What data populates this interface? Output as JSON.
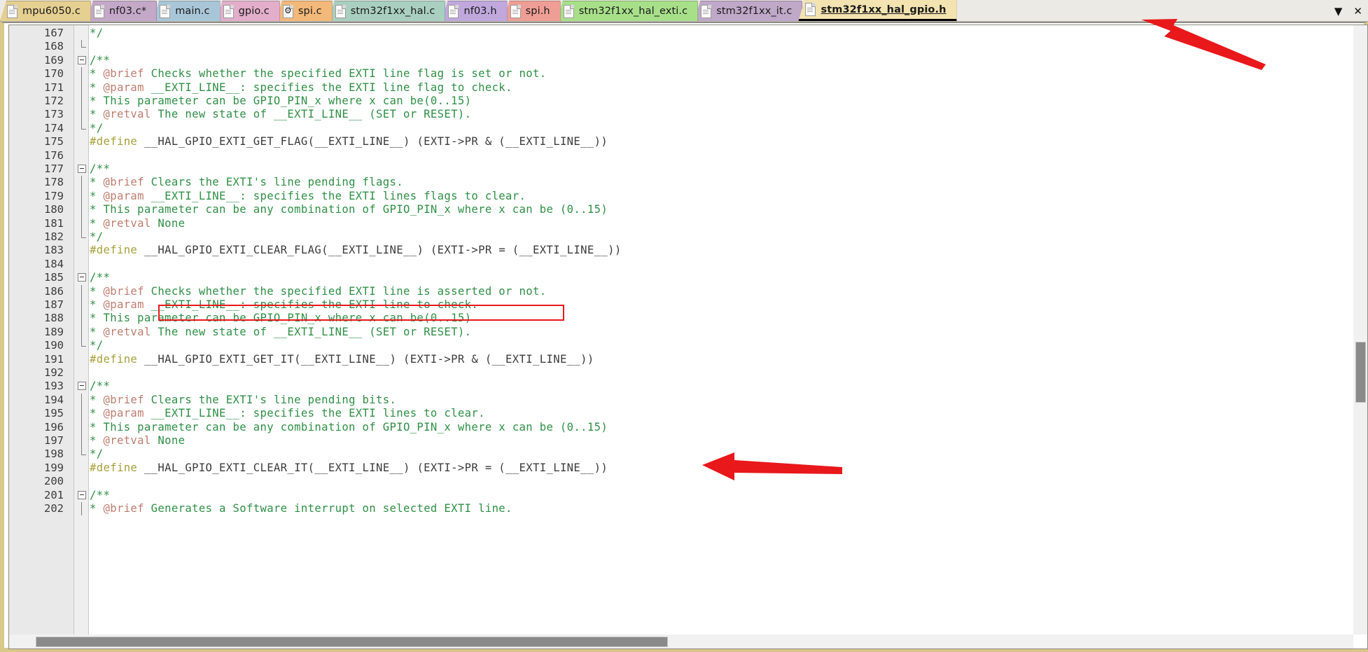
{
  "window": {
    "title": "stm32f1xx_hal_gpio.h",
    "accent_frame_color": "#d8c98b",
    "annotation_color": "#e8181b"
  },
  "tabbar": {
    "controls": [
      {
        "name": "tab-list-dropdown",
        "glyph": "▼",
        "label": "Tab list"
      },
      {
        "name": "close-tab-button",
        "glyph": "✕",
        "label": "Close"
      }
    ],
    "tabs": [
      {
        "label": "mpu6050.c",
        "color": "#e5cf91",
        "icon": "file-icon",
        "active": false,
        "modified": false
      },
      {
        "label": "nf03.c*",
        "color": "#c4a8c8",
        "icon": "file-icon",
        "active": false,
        "modified": true
      },
      {
        "label": "main.c",
        "color": "#a9c6d8",
        "icon": "file-icon",
        "active": false,
        "modified": false
      },
      {
        "label": "gpio.c",
        "color": "#e2aec9",
        "icon": "file-icon",
        "active": false,
        "modified": false
      },
      {
        "label": "spi.c",
        "color": "#f2b97a",
        "icon": "gear-file-icon",
        "active": false,
        "modified": false
      },
      {
        "label": "stm32f1xx_hal.c",
        "color": "#a9cfc0",
        "icon": "file-icon",
        "active": false,
        "modified": false
      },
      {
        "label": "nf03.h",
        "color": "#c0a8dd",
        "icon": "file-icon",
        "active": false,
        "modified": false
      },
      {
        "label": "spi.h",
        "color": "#ef9e95",
        "icon": "file-icon",
        "active": false,
        "modified": false
      },
      {
        "label": "stm32f1xx_hal_exti.c",
        "color": "#a8e08a",
        "icon": "file-icon",
        "active": false,
        "modified": false
      },
      {
        "label": "stm32f1xx_it.c",
        "color": "#c0a8c8",
        "icon": "file-icon",
        "active": false,
        "modified": false
      },
      {
        "label": "stm32f1xx_hal_gpio.h",
        "color": "#f2e3b0",
        "icon": "file-icon",
        "active": true,
        "modified": false
      }
    ]
  },
  "editor": {
    "first_line": 167,
    "syntax_colors": {
      "comment": "#2f8f46",
      "doc_tag": "#bf7d6e",
      "preprocessor": "#a6a13a",
      "identifier": "#3c3c3c",
      "gutter_bg": "#e9e9e9",
      "background": "#ffffff"
    },
    "lines": [
      {
        "n": 167,
        "fold": "none",
        "segs": [
          {
            "t": "   */",
            "c": "comment"
          }
        ]
      },
      {
        "n": 168,
        "fold": "end",
        "segs": []
      },
      {
        "n": 169,
        "fold": "start",
        "segs": [
          {
            "t": "/**",
            "c": "comment"
          }
        ]
      },
      {
        "n": 170,
        "fold": "mid",
        "segs": [
          {
            "t": "  * ",
            "c": "comment"
          },
          {
            "t": "@brief",
            "c": "doctag"
          },
          {
            "t": "  Checks whether the specified EXTI line flag is set or not.",
            "c": "comment"
          }
        ]
      },
      {
        "n": 171,
        "fold": "mid",
        "segs": [
          {
            "t": "  * ",
            "c": "comment"
          },
          {
            "t": "@param",
            "c": "doctag"
          },
          {
            "t": "  __EXTI_LINE__: specifies the EXTI line flag to check.",
            "c": "comment"
          }
        ]
      },
      {
        "n": 172,
        "fold": "mid",
        "segs": [
          {
            "t": "  *         This parameter can be GPIO_PIN_x where x can be(0..15)",
            "c": "comment"
          }
        ]
      },
      {
        "n": 173,
        "fold": "mid",
        "segs": [
          {
            "t": "  * ",
            "c": "comment"
          },
          {
            "t": "@retval",
            "c": "doctag"
          },
          {
            "t": " The new state of __EXTI_LINE__ (SET or RESET).",
            "c": "comment"
          }
        ]
      },
      {
        "n": 174,
        "fold": "end",
        "segs": [
          {
            "t": "  */",
            "c": "comment"
          }
        ]
      },
      {
        "n": 175,
        "fold": "none",
        "segs": [
          {
            "t": "#define",
            "c": "pre"
          },
          {
            "t": " __HAL_GPIO_EXTI_GET_FLAG(__EXTI_LINE__) (EXTI->PR & (__EXTI_LINE__))",
            "c": "ident"
          }
        ]
      },
      {
        "n": 176,
        "fold": "none",
        "segs": []
      },
      {
        "n": 177,
        "fold": "start",
        "segs": [
          {
            "t": "/**",
            "c": "comment"
          }
        ]
      },
      {
        "n": 178,
        "fold": "mid",
        "segs": [
          {
            "t": "  * ",
            "c": "comment"
          },
          {
            "t": "@brief",
            "c": "doctag"
          },
          {
            "t": "  Clears the EXTI's line pending flags.",
            "c": "comment"
          }
        ]
      },
      {
        "n": 179,
        "fold": "mid",
        "segs": [
          {
            "t": "  * ",
            "c": "comment"
          },
          {
            "t": "@param",
            "c": "doctag"
          },
          {
            "t": "  __EXTI_LINE__: specifies the EXTI lines flags to clear.",
            "c": "comment"
          }
        ]
      },
      {
        "n": 180,
        "fold": "mid",
        "segs": [
          {
            "t": "  *        This parameter can be any combination of GPIO_PIN_x where x can be (0..15)",
            "c": "comment"
          }
        ]
      },
      {
        "n": 181,
        "fold": "mid",
        "segs": [
          {
            "t": "  * ",
            "c": "comment"
          },
          {
            "t": "@retval",
            "c": "doctag"
          },
          {
            "t": " None",
            "c": "comment"
          }
        ]
      },
      {
        "n": 182,
        "fold": "end",
        "segs": [
          {
            "t": "  */",
            "c": "comment"
          }
        ]
      },
      {
        "n": 183,
        "fold": "none",
        "segs": [
          {
            "t": "#define",
            "c": "pre"
          },
          {
            "t": " __HAL_GPIO_EXTI_CLEAR_FLAG(__EXTI_LINE__) (EXTI->PR = (__EXTI_LINE__))",
            "c": "ident"
          }
        ]
      },
      {
        "n": 184,
        "fold": "none",
        "segs": []
      },
      {
        "n": 185,
        "fold": "start",
        "segs": [
          {
            "t": "/**",
            "c": "comment"
          }
        ]
      },
      {
        "n": 186,
        "fold": "mid",
        "segs": [
          {
            "t": "  * ",
            "c": "comment"
          },
          {
            "t": "@brief",
            "c": "doctag"
          },
          {
            "t": "  Checks whether the specified EXTI line is asserted or not.",
            "c": "comment"
          }
        ]
      },
      {
        "n": 187,
        "fold": "mid",
        "segs": [
          {
            "t": "  * ",
            "c": "comment"
          },
          {
            "t": "@param",
            "c": "doctag"
          },
          {
            "t": "  __EXTI_LINE__: specifies the EXTI line to check.",
            "c": "comment"
          }
        ]
      },
      {
        "n": 188,
        "fold": "mid",
        "segs": [
          {
            "t": "  *         This parameter can be GPIO_PIN_x where x can be(0..15)",
            "c": "comment"
          }
        ]
      },
      {
        "n": 189,
        "fold": "mid",
        "segs": [
          {
            "t": "  * ",
            "c": "comment"
          },
          {
            "t": "@retval",
            "c": "doctag"
          },
          {
            "t": " The new state of __EXTI_LINE__ (SET or RESET).",
            "c": "comment"
          }
        ]
      },
      {
        "n": 190,
        "fold": "end",
        "segs": [
          {
            "t": "  */",
            "c": "comment"
          }
        ]
      },
      {
        "n": 191,
        "fold": "none",
        "segs": [
          {
            "t": "#define",
            "c": "pre"
          },
          {
            "t": " __HAL_GPIO_EXTI_GET_IT(__EXTI_LINE__) (EXTI->PR & (__EXTI_LINE__))",
            "c": "ident"
          }
        ]
      },
      {
        "n": 192,
        "fold": "none",
        "segs": []
      },
      {
        "n": 193,
        "fold": "start",
        "segs": [
          {
            "t": "/**",
            "c": "comment"
          }
        ]
      },
      {
        "n": 194,
        "fold": "mid",
        "segs": [
          {
            "t": "  * ",
            "c": "comment"
          },
          {
            "t": "@brief",
            "c": "doctag"
          },
          {
            "t": "  Clears the EXTI's line pending bits.",
            "c": "comment"
          }
        ]
      },
      {
        "n": 195,
        "fold": "mid",
        "segs": [
          {
            "t": "  * ",
            "c": "comment"
          },
          {
            "t": "@param",
            "c": "doctag"
          },
          {
            "t": "  __EXTI_LINE__: specifies the EXTI lines to clear.",
            "c": "comment"
          }
        ]
      },
      {
        "n": 196,
        "fold": "mid",
        "segs": [
          {
            "t": "  *         This parameter can be any combination of GPIO_PIN_x where x can be (0..15)",
            "c": "comment"
          }
        ]
      },
      {
        "n": 197,
        "fold": "mid",
        "segs": [
          {
            "t": "  * ",
            "c": "comment"
          },
          {
            "t": "@retval",
            "c": "doctag"
          },
          {
            "t": " None",
            "c": "comment"
          }
        ]
      },
      {
        "n": 198,
        "fold": "end",
        "segs": [
          {
            "t": "  */",
            "c": "comment"
          }
        ]
      },
      {
        "n": 199,
        "fold": "none",
        "segs": [
          {
            "t": "#define",
            "c": "pre"
          },
          {
            "t": " __HAL_GPIO_EXTI_CLEAR_IT(__EXTI_LINE__) (EXTI->PR = (__EXTI_LINE__))",
            "c": "ident"
          }
        ]
      },
      {
        "n": 200,
        "fold": "none",
        "segs": []
      },
      {
        "n": 201,
        "fold": "start",
        "segs": [
          {
            "t": "/**",
            "c": "comment"
          }
        ]
      },
      {
        "n": 202,
        "fold": "mid",
        "segs": [
          {
            "t": "  * ",
            "c": "comment"
          },
          {
            "t": "@brief",
            "c": "doctag"
          },
          {
            "t": "  Generates a Software interrupt on selected EXTI line.",
            "c": "comment"
          }
        ]
      }
    ]
  },
  "annotations": {
    "highlight_box": {
      "name": "red-highlight-box",
      "target_line": 186,
      "target_text": "Checks whether the specified EXTI line is asserted or not."
    },
    "arrows": [
      {
        "name": "arrow-to-active-tab",
        "points_to": "stm32f1xx_hal_gpio.h tab"
      },
      {
        "name": "arrow-to-get-it-macro",
        "points_to": "__HAL_GPIO_EXTI_GET_IT macro on line 191"
      }
    ]
  },
  "scrollbars": {
    "vertical": {
      "name": "vertical-scrollbar",
      "thumb_top_pct": 52,
      "thumb_height_pct": 10
    },
    "horizontal": {
      "name": "horizontal-scrollbar",
      "thumb_left_pct": 2,
      "thumb_width_pct": 47
    }
  }
}
